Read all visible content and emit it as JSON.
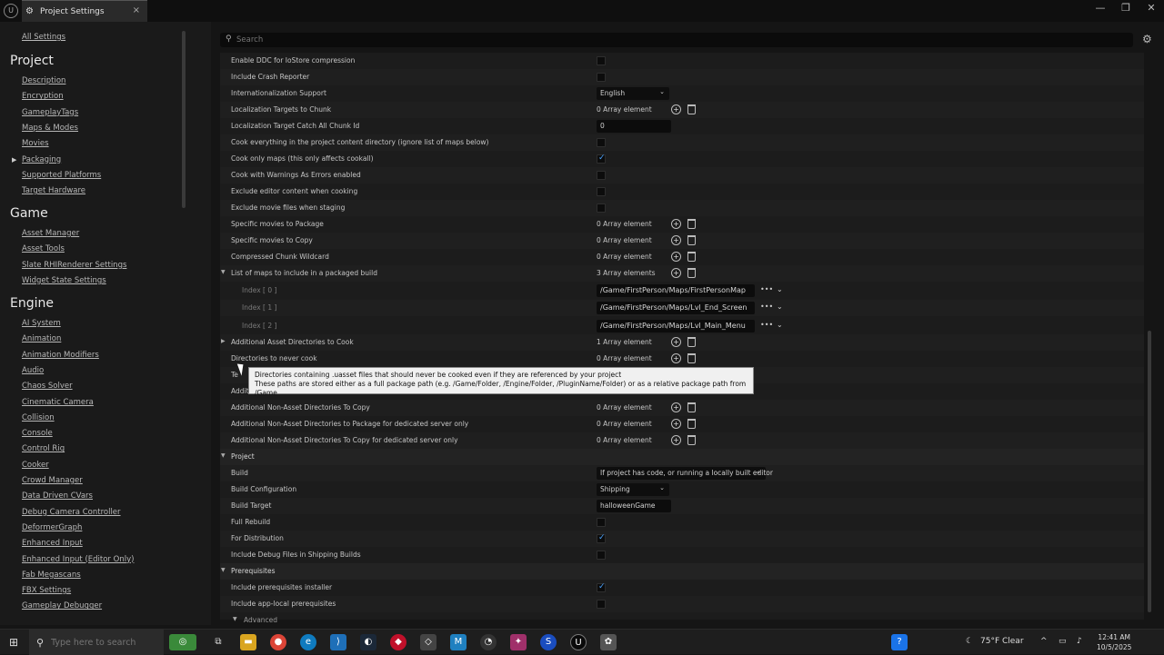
{
  "window": {
    "tab_title": "Project Settings",
    "tab_close": "×",
    "minimize": "—",
    "maximize": "❐",
    "close": "✕"
  },
  "sidebar": {
    "all_settings": "All Settings",
    "sections": [
      {
        "heading": "Project",
        "items": [
          "Description",
          "Encryption",
          "GameplayTags",
          "Maps & Modes",
          "Movies",
          "Packaging",
          "Supported Platforms",
          "Target Hardware"
        ]
      },
      {
        "heading": "Game",
        "items": [
          "Asset Manager",
          "Asset Tools",
          "Slate RHIRenderer Settings",
          "Widget State Settings"
        ]
      },
      {
        "heading": "Engine",
        "items": [
          "AI System",
          "Animation",
          "Animation Modifiers",
          "Audio",
          "Chaos Solver",
          "Cinematic Camera",
          "Collision",
          "Console",
          "Control Rig",
          "Cooker",
          "Crowd Manager",
          "Data Driven CVars",
          "Debug Camera Controller",
          "DeformerGraph",
          "Enhanced Input",
          "Enhanced Input (Editor Only)",
          "Fab Megascans",
          "FBX Settings",
          "Gameplay Debugger"
        ]
      }
    ]
  },
  "search": {
    "placeholder": "Search"
  },
  "rows": [
    {
      "label": "Enable DDC for IoStore compression",
      "type": "checkbox",
      "checked": false
    },
    {
      "label": "Include Crash Reporter",
      "type": "checkbox",
      "checked": false
    },
    {
      "label": "Internationalization Support",
      "type": "combo",
      "value": "English"
    },
    {
      "label": "Localization Targets to Chunk",
      "type": "array",
      "value": "0 Array element"
    },
    {
      "label": "Localization Target Catch All Chunk Id",
      "type": "text",
      "value": "0"
    },
    {
      "label": "Cook everything in the project content directory (ignore list of maps below)",
      "type": "checkbox",
      "checked": false
    },
    {
      "label": "Cook only maps (this only affects cookall)",
      "type": "checkbox",
      "checked": true
    },
    {
      "label": "Cook with Warnings As Errors enabled",
      "type": "checkbox",
      "checked": false
    },
    {
      "label": "Exclude editor content when cooking",
      "type": "checkbox",
      "checked": false
    },
    {
      "label": "Exclude movie files when staging",
      "type": "checkbox",
      "checked": false
    },
    {
      "label": "Specific movies to Package",
      "type": "array",
      "value": "0 Array element"
    },
    {
      "label": "Specific movies to Copy",
      "type": "array",
      "value": "0 Array element"
    },
    {
      "label": "Compressed Chunk Wildcard",
      "type": "array",
      "value": "0 Array element"
    },
    {
      "label": "List of maps to include in a packaged build",
      "type": "array",
      "value": "3 Array elements",
      "expanded": true
    },
    {
      "label": "Index [ 0 ]",
      "type": "path",
      "value": "/Game/FirstPerson/Maps/FirstPersonMap"
    },
    {
      "label": "Index [ 1 ]",
      "type": "path",
      "value": "/Game/FirstPerson/Maps/Lvl_End_Screen"
    },
    {
      "label": "Index [ 2 ]",
      "type": "path",
      "value": "/Game/FirstPerson/Maps/Lvl_Main_Menu"
    },
    {
      "label": "Additional Asset Directories to Cook",
      "type": "array",
      "value": "1 Array element",
      "collapsed": true
    },
    {
      "label": "Directories to never cook",
      "type": "array",
      "value": "0 Array element"
    },
    {
      "label": "Te",
      "type": "none"
    },
    {
      "label": "Additi",
      "type": "none"
    },
    {
      "label": "Additional Non-Asset Directories To Copy",
      "type": "array",
      "value": "0 Array element"
    },
    {
      "label": "Additional Non-Asset Directories to Package for dedicated server only",
      "type": "array",
      "value": "0 Array element"
    },
    {
      "label": "Additional Non-Asset Directories To Copy for dedicated server only",
      "type": "array",
      "value": "0 Array element"
    },
    {
      "label": "Project",
      "type": "section"
    },
    {
      "label": "Build",
      "type": "combo",
      "value": "If project has code, or running a locally built editor"
    },
    {
      "label": "Build Configuration",
      "type": "combo",
      "value": "Shipping"
    },
    {
      "label": "Build Target",
      "type": "text",
      "value": "halloweenGame"
    },
    {
      "label": "Full Rebuild",
      "type": "checkbox",
      "checked": false
    },
    {
      "label": "For Distribution",
      "type": "checkbox",
      "checked": true
    },
    {
      "label": "Include Debug Files in Shipping Builds",
      "type": "checkbox",
      "checked": false
    },
    {
      "label": "Prerequisites",
      "type": "section"
    },
    {
      "label": "Include prerequisites installer",
      "type": "checkbox",
      "checked": true
    },
    {
      "label": "Include app-local prerequisites",
      "type": "checkbox",
      "checked": false
    },
    {
      "label": "Advanced",
      "type": "advanced"
    }
  ],
  "tooltip": {
    "line1": "Directories containing .uasset files that should never be cooked even if they are referenced by your project",
    "line2": "These paths are stored either as a full package path (e.g. /Game/Folder, /Engine/Folder, /PluginName/Folder) or as a relative package path from /Game"
  },
  "taskbar": {
    "search_placeholder": "Type here to search",
    "weather": "75°F  Clear",
    "time": "12:41 AM",
    "date": "10/5/2025"
  },
  "colors": {
    "accent": "#4aa3ff",
    "background": "#151515"
  }
}
